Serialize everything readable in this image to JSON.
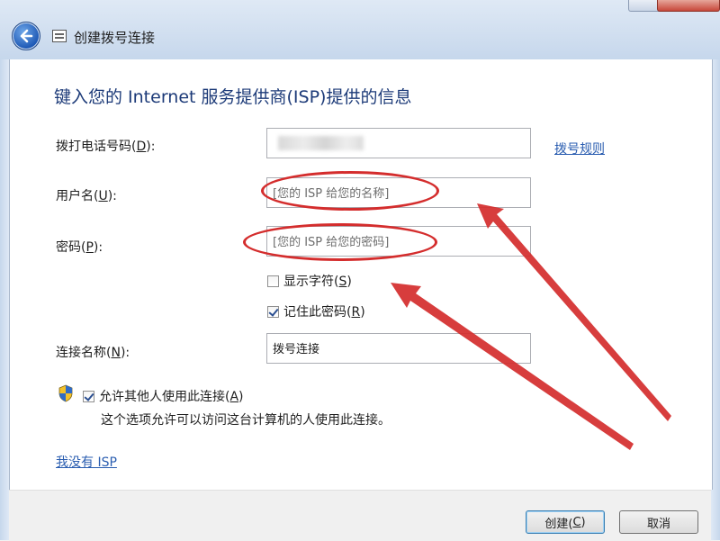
{
  "window": {
    "title": "创建拨号连接",
    "back_icon": "back-arrow-icon",
    "accent_color": "#1c57b4"
  },
  "heading": "键入您的 Internet 服务提供商(ISP)提供的信息",
  "fields": {
    "phone": {
      "label": "拨打电话号码(D):",
      "label_pre": "拨打电话号码(",
      "mnemonic": "D",
      "label_post": "):",
      "value": ""
    },
    "username": {
      "label_pre": "用户名(",
      "mnemonic": "U",
      "label_post": "):",
      "placeholder": "[您的 ISP 给您的名称]"
    },
    "password": {
      "label_pre": "密码(",
      "mnemonic": "P",
      "label_post": "):",
      "placeholder": "[您的 ISP 给您的密码]"
    },
    "connection_name": {
      "label_pre": "连接名称(",
      "mnemonic": "N",
      "label_post": "):",
      "value": "拨号连接"
    }
  },
  "dialing_rules_link": "拨号规则",
  "checkboxes": {
    "show_chars": {
      "label_pre": "显示字符(",
      "mnemonic": "S",
      "label_post": ")",
      "checked": false
    },
    "remember_password": {
      "label_pre": "记住此密码(",
      "mnemonic": "R",
      "label_post": ")",
      "checked": true
    },
    "allow_others": {
      "label_pre": "允许其他人使用此连接(",
      "mnemonic": "A",
      "label_post": ")",
      "checked": true,
      "icon": "uac-shield-icon"
    }
  },
  "allow_others_note": "这个选项允许可以访问这台计算机的人使用此连接。",
  "no_isp_link": "我没有 ISP",
  "buttons": {
    "create": {
      "label_pre": "创建(",
      "mnemonic": "C",
      "label_post": ")"
    },
    "cancel": {
      "label": "取消"
    }
  },
  "annotation_color": "#d42d2d"
}
